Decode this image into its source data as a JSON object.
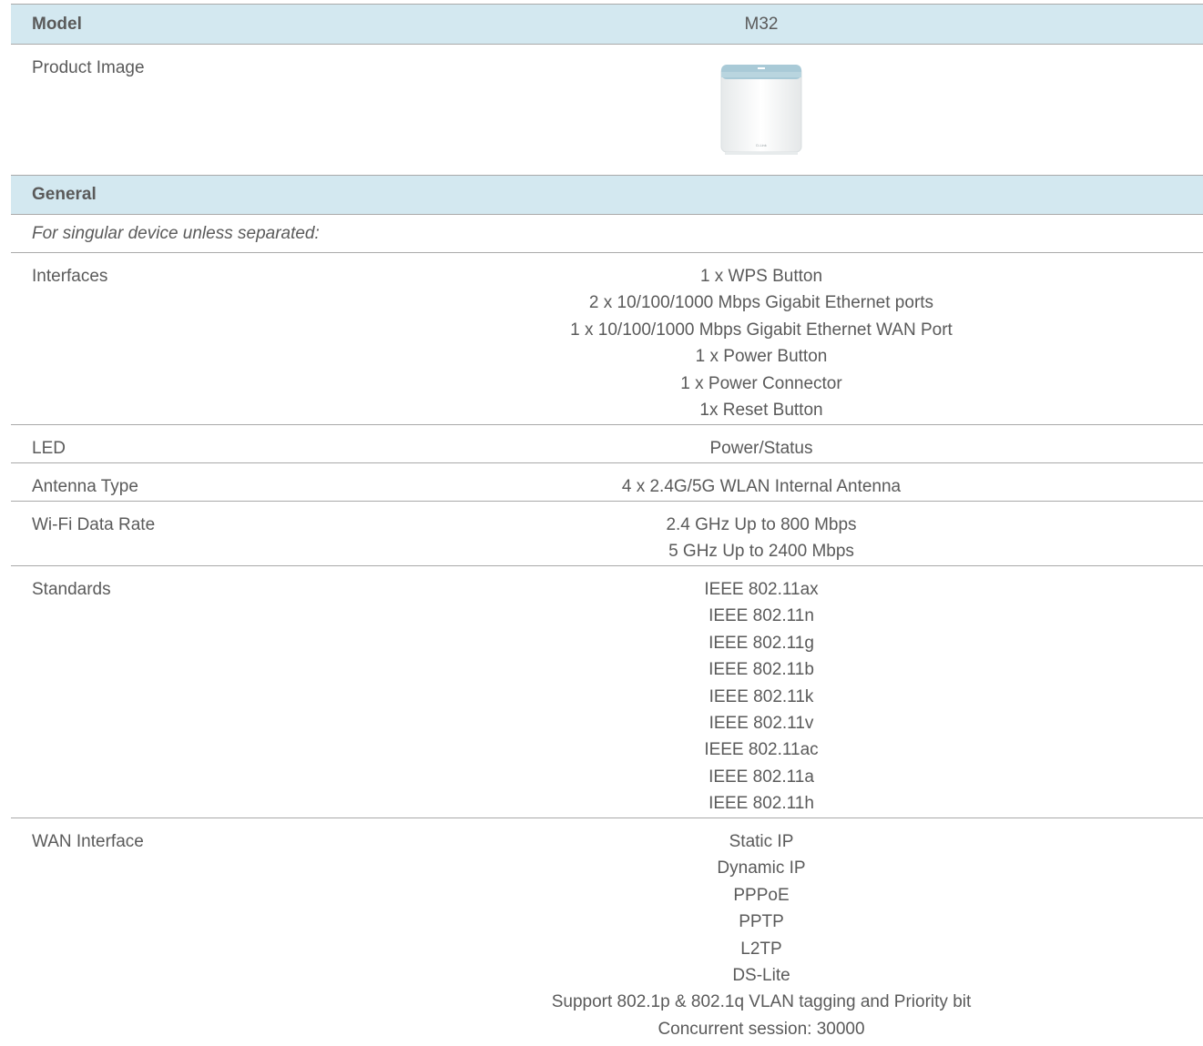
{
  "model_row": {
    "label": "Model",
    "value": "M32"
  },
  "image_row": {
    "label": "Product Image",
    "device_logo": "D-Link"
  },
  "general_row": {
    "label": "General"
  },
  "note": "For singular device unless separated:",
  "rows": [
    {
      "label": "Interfaces",
      "values": [
        "1 x WPS Button",
        "2 x 10/100/1000 Mbps Gigabit Ethernet ports",
        "1 x 10/100/1000 Mbps Gigabit Ethernet WAN Port",
        "1 x Power Button",
        "1 x Power Connector",
        "1x Reset Button"
      ]
    },
    {
      "label": "LED",
      "values": [
        "Power/Status"
      ]
    },
    {
      "label": "Antenna Type",
      "values": [
        "4 x 2.4G/5G WLAN Internal Antenna"
      ]
    },
    {
      "label": "Wi-Fi Data Rate",
      "values": [
        "2.4 GHz Up to 800 Mbps",
        "5 GHz Up to 2400 Mbps"
      ]
    },
    {
      "label": "Standards",
      "values": [
        "IEEE 802.11ax",
        "IEEE 802.11n",
        "IEEE 802.11g",
        "IEEE 802.11b",
        "IEEE 802.11k",
        "IEEE 802.11v",
        "IEEE 802.11ac",
        "IEEE 802.11a",
        "IEEE 802.11h"
      ]
    },
    {
      "label": "WAN Interface",
      "values": [
        "Static IP",
        "Dynamic IP",
        "PPPoE",
        "PPTP",
        "L2TP",
        "DS-Lite",
        "Support 802.1p & 802.1q VLAN tagging and Priority bit",
        "Concurrent session: 30000"
      ]
    }
  ]
}
